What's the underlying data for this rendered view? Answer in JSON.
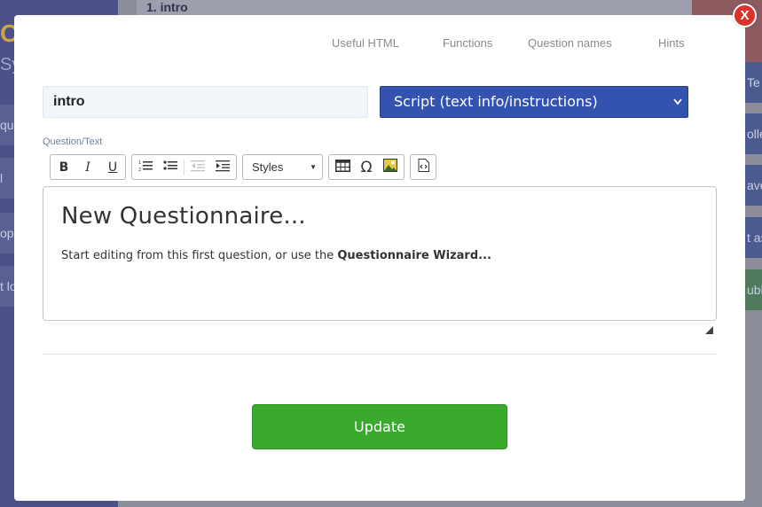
{
  "background": {
    "item_title": "1. intro",
    "logo_letter": "O",
    "sys_text": "Sy",
    "left_rows": [
      "qu",
      "l",
      "ope",
      "t lo"
    ],
    "right_buttons": [
      "Te",
      "olle",
      "ave",
      "t as",
      "ubli"
    ]
  },
  "modal": {
    "close_label": "X",
    "help_tabs": [
      "Useful HTML",
      "Functions",
      "Question names",
      "Hints"
    ],
    "name_value": "intro",
    "type_selected": "Script (text info/instructions)",
    "field_label": "Question/Text",
    "toolbar": {
      "bold": "B",
      "italic": "I",
      "underline": "U",
      "styles_label": "Styles",
      "special_char": "Ω"
    },
    "editor": {
      "heading": "New Questionnaire...",
      "para_text": "Start editing from this first question, or use the ",
      "para_bold": "Questionnaire Wizard..."
    },
    "update_label": "Update"
  },
  "colors": {
    "accent_blue": "#3452b0",
    "update_green": "#3aaa2e",
    "close_red": "#d9342b"
  }
}
